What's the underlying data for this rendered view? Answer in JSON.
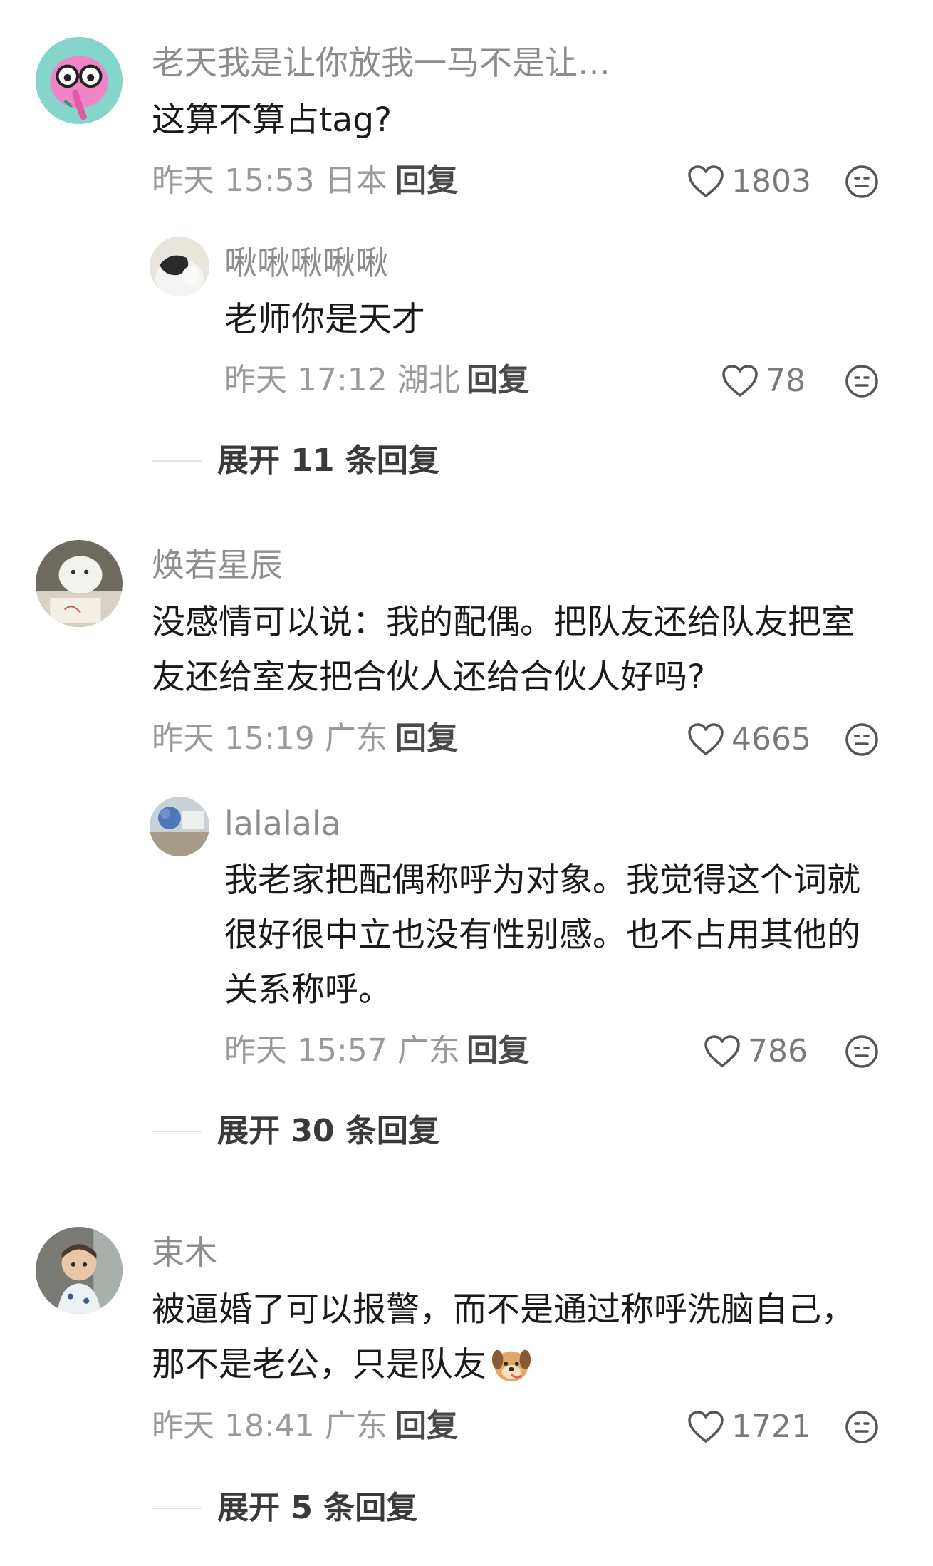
{
  "comments": [
    {
      "user": "老天我是让你放我一马不是让…",
      "text_lines": [
        "这算不算占tag?"
      ],
      "time": "昨天 15:53",
      "location": "日本",
      "reply_label": "回复",
      "likes": "1803",
      "sub": {
        "user": "啾啾啾啾啾",
        "text_lines": [
          "老师你是天才"
        ],
        "time": "昨天 17:12",
        "location": "湖北",
        "reply_label": "回复",
        "likes": "78"
      },
      "expand": "展开 11 条回复"
    },
    {
      "user": "焕若星辰",
      "text_lines": [
        "没感情可以说：我的配偶。把队友还给队友把室",
        "友还给室友把合伙人还给合伙人好吗?"
      ],
      "time": "昨天 15:19",
      "location": "广东",
      "reply_label": "回复",
      "likes": "4665",
      "sub": {
        "user": "lalalala",
        "text_lines": [
          "我老家把配偶称呼为对象。我觉得这个词就",
          "很好很中立也没有性别感。也不占用其他的",
          "关系称呼。"
        ],
        "time": "昨天 15:57",
        "location": "广东",
        "reply_label": "回复",
        "likes": "786"
      },
      "expand": "展开 30 条回复"
    },
    {
      "user": "束木",
      "text_lines": [
        "被逼婚了可以报警，而不是通过称呼洗脑自己，",
        "那不是老公，只是队友"
      ],
      "time": "昨天 18:41",
      "location": "广东",
      "reply_label": "回复",
      "likes": "1721",
      "expand": "展开 5 条回复"
    }
  ],
  "icons": {
    "like": "heart-outline-icon",
    "more": "smiley-icon",
    "emoji_inline": "dog-emoji"
  },
  "colors": {
    "username": "#8d8d8d",
    "meta": "#9a9a9a",
    "text": "#1a1a1a"
  }
}
